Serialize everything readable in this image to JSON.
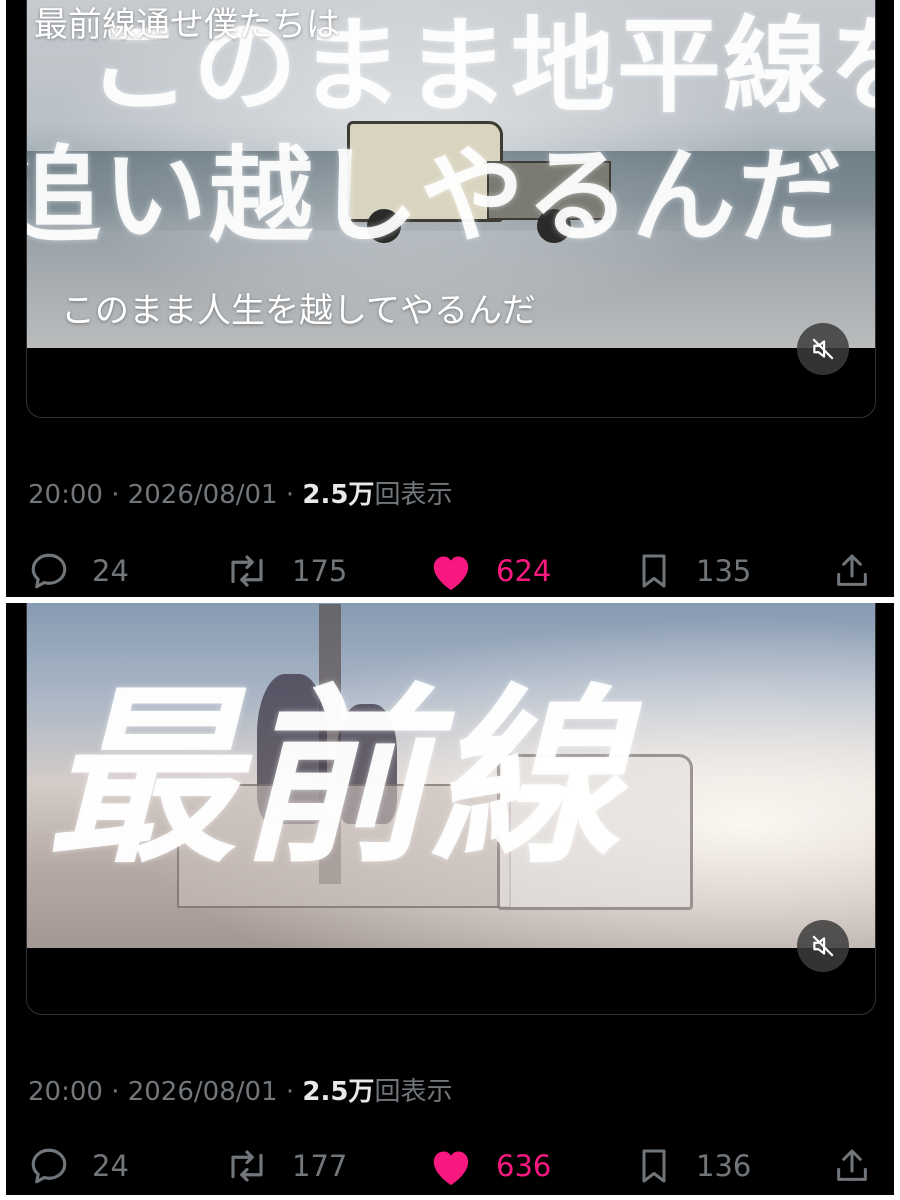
{
  "posts": [
    {
      "video_title_lines": [
        "このまま地平線を",
        "追い越しやるんだ"
      ],
      "caption": "このまま人生を越してやるんだ",
      "timestamp": "20:00 · 2026/08/01 · ",
      "views": "2.5万",
      "views_label": "回表示",
      "replies": "24",
      "reposts": "175",
      "likes": "624",
      "bookmarks": "135"
    },
    {
      "video_title_lines": [
        "最前線"
      ],
      "caption": "最前線通せ僕たちは",
      "timestamp": "20:00 · 2026/08/01 · ",
      "views": "2.5万",
      "views_label": "回表示",
      "replies": "24",
      "reposts": "177",
      "likes": "636",
      "bookmarks": "136"
    }
  ],
  "colors": {
    "background": "#000000",
    "muted_text": "#71767b",
    "like_pink": "#f91880",
    "divider": "#ffffff"
  },
  "icons": [
    "reply-icon",
    "repost-icon",
    "like-heart-icon",
    "bookmark-icon",
    "share-icon",
    "mute-icon"
  ]
}
